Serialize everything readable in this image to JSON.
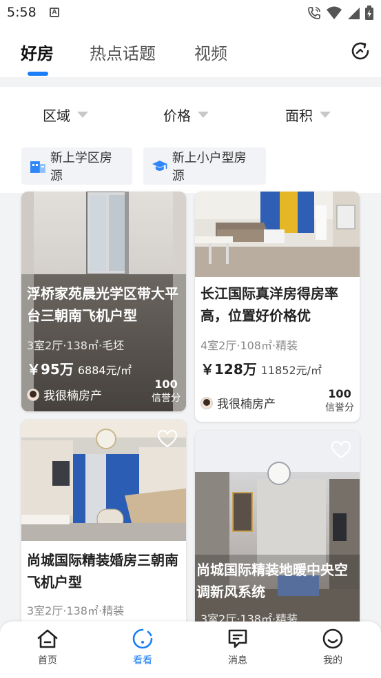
{
  "status_bar": {
    "time": "5:58",
    "notification_icon": "A"
  },
  "top_tabs": [
    {
      "label": "好房",
      "active": true
    },
    {
      "label": "热点话题",
      "active": false
    },
    {
      "label": "视频",
      "active": false
    }
  ],
  "filters": [
    {
      "label": "区域"
    },
    {
      "label": "价格"
    },
    {
      "label": "面积"
    }
  ],
  "chips": [
    {
      "label": "新上学区房源",
      "icon": "school-building-icon"
    },
    {
      "label": "新上小户型房源",
      "icon": "graduation-cap-icon"
    }
  ],
  "listings": [
    {
      "title": "浮桥家苑晨光学区带大平台三朝南飞机户型",
      "spec": "3室2厅·138㎡·毛坯",
      "price_total": "￥95万",
      "price_unit": "6884元/㎡",
      "agent": "我很楠房产",
      "score": "100",
      "score_label": "信誉分"
    },
    {
      "title": "长江国际真洋房得房率高，位置好价格优",
      "spec": "4室2厅·108㎡·精装",
      "price_total": "￥128万",
      "price_unit": "11852元/㎡",
      "agent": "我很楠房产",
      "score": "100",
      "score_label": "信誉分"
    },
    {
      "title": "尚城国际精装婚房三朝南飞机户型",
      "spec": "3室2厅·138㎡·精装"
    },
    {
      "title": "尚城国际精装地暖中央空调新风系统",
      "spec": "3室2厅·138㎡·精装"
    }
  ],
  "bottom_nav": [
    {
      "label": "首页",
      "icon": "home-icon",
      "active": false
    },
    {
      "label": "看看",
      "icon": "look-icon",
      "active": true
    },
    {
      "label": "消息",
      "icon": "message-icon",
      "active": false
    },
    {
      "label": "我的",
      "icon": "smiley-icon",
      "active": false
    }
  ],
  "colors": {
    "accent": "#1a7ef7",
    "background": "#f2f3f5",
    "text": "#222222"
  }
}
